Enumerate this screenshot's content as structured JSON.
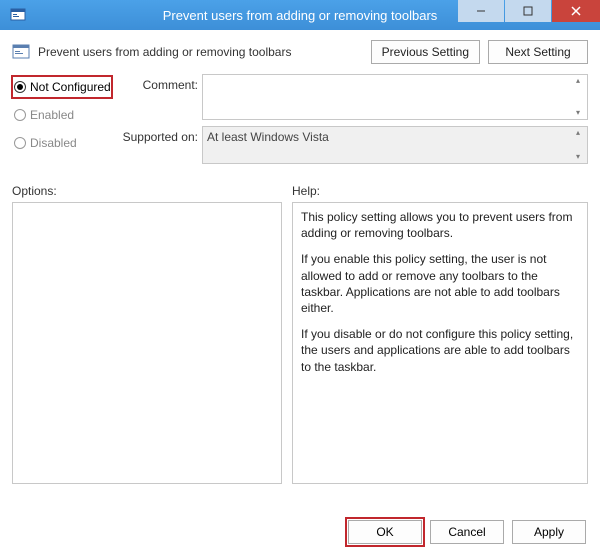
{
  "window": {
    "title": "Prevent users from adding or removing toolbars"
  },
  "header": {
    "title": "Prevent users from adding or removing toolbars",
    "previous": "Previous Setting",
    "next": "Next Setting"
  },
  "radios": {
    "not_configured": "Not Configured",
    "enabled": "Enabled",
    "disabled": "Disabled",
    "selected": "not_configured"
  },
  "fields": {
    "comment_label": "Comment:",
    "comment_value": "",
    "supported_label": "Supported on:",
    "supported_value": "At least Windows Vista"
  },
  "labels": {
    "options": "Options:",
    "help": "Help:"
  },
  "help": {
    "p1": "This policy setting allows you to prevent users from adding or removing toolbars.",
    "p2": "If you enable this policy setting, the user is not allowed to add or remove any toolbars to the taskbar. Applications are not able to add toolbars either.",
    "p3": "If you disable or do not configure this policy setting, the users and applications are able to add toolbars to the taskbar."
  },
  "footer": {
    "ok": "OK",
    "cancel": "Cancel",
    "apply": "Apply"
  }
}
